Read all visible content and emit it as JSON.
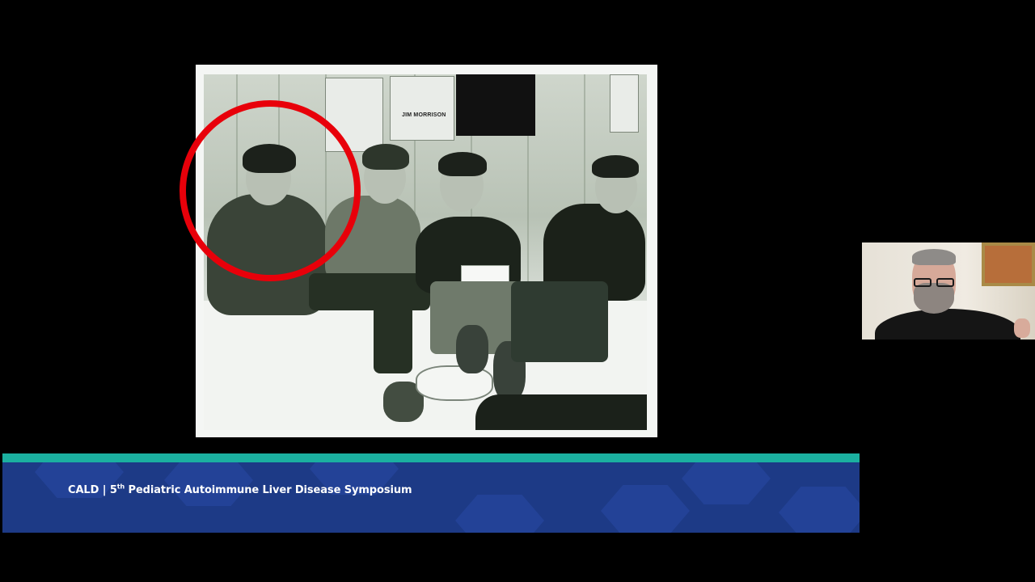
{
  "slide": {
    "poster_caption": "JIM MORRISON",
    "highlight_color": "#e8000a"
  },
  "banner": {
    "org": "CALD",
    "separator": "|",
    "edition_number": "5",
    "edition_suffix": "th",
    "event_title": "Pediatric Autoimmune Liver Disease Symposium",
    "accent_color": "#1bb0a0",
    "background_color": "#1d3a86"
  },
  "speaker": {
    "tile": "speaker-video-thumbnail"
  }
}
